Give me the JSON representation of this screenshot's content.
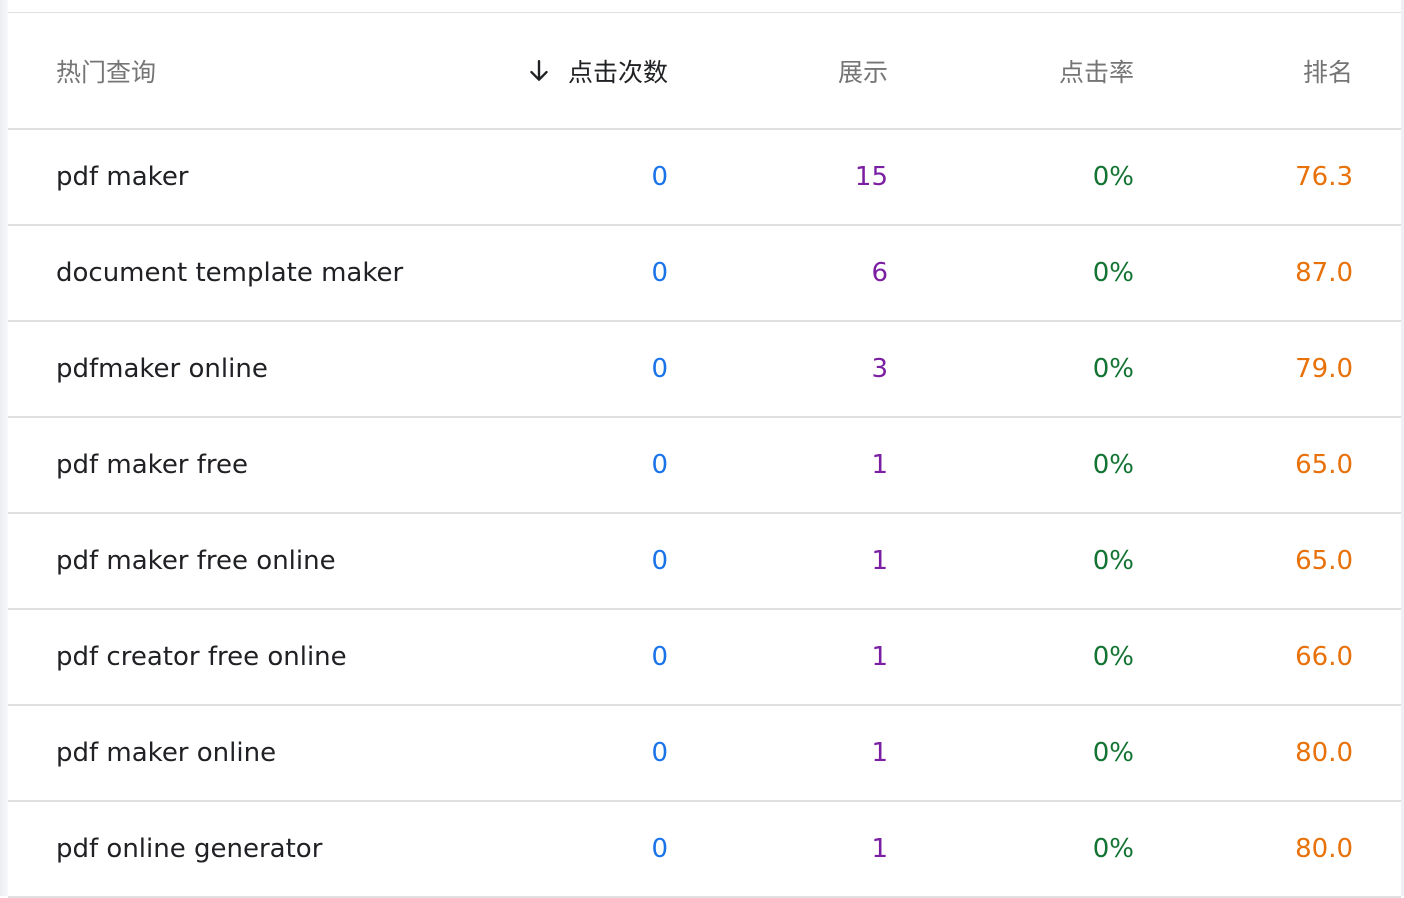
{
  "colors": {
    "clicks": "#1a73e8",
    "impressions": "#7b1fa2",
    "ctr": "#137333",
    "position": "#e8710a",
    "header": "#757575",
    "text": "#202124"
  },
  "header": {
    "query": "热门查询",
    "clicks": "点击次数",
    "impressions": "展示",
    "ctr": "点击率",
    "position": "排名",
    "sort_icon": "arrow-down-icon"
  },
  "rows": [
    {
      "query": "pdf maker",
      "clicks": "0",
      "impressions": "15",
      "ctr": "0%",
      "position": "76.3"
    },
    {
      "query": "document template maker",
      "clicks": "0",
      "impressions": "6",
      "ctr": "0%",
      "position": "87.0"
    },
    {
      "query": "pdfmaker online",
      "clicks": "0",
      "impressions": "3",
      "ctr": "0%",
      "position": "79.0"
    },
    {
      "query": "pdf maker free",
      "clicks": "0",
      "impressions": "1",
      "ctr": "0%",
      "position": "65.0"
    },
    {
      "query": "pdf maker free online",
      "clicks": "0",
      "impressions": "1",
      "ctr": "0%",
      "position": "65.0"
    },
    {
      "query": "pdf creator free online",
      "clicks": "0",
      "impressions": "1",
      "ctr": "0%",
      "position": "66.0"
    },
    {
      "query": "pdf maker online",
      "clicks": "0",
      "impressions": "1",
      "ctr": "0%",
      "position": "80.0"
    },
    {
      "query": "pdf online generator",
      "clicks": "0",
      "impressions": "1",
      "ctr": "0%",
      "position": "80.0"
    }
  ]
}
